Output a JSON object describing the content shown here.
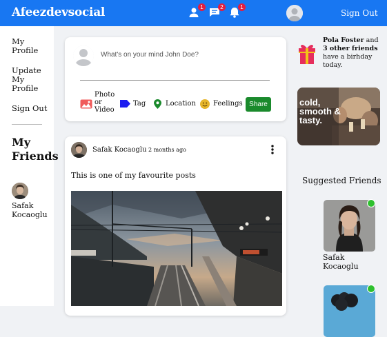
{
  "topbar": {
    "brand": "Afeezdevsocial",
    "badges": {
      "friends": "1",
      "messages": "2",
      "notifications": "1"
    },
    "sign_out": "Sign Out"
  },
  "sidebar": {
    "links": [
      {
        "label": "My Profile"
      },
      {
        "label": "Update My Profile"
      },
      {
        "label": "Sign Out"
      }
    ],
    "friends_heading": "My Friends",
    "friends": [
      {
        "name": "Safak Kocaoglu"
      }
    ]
  },
  "composer": {
    "placeholder": "What's on your mind John Doe?",
    "options": {
      "photo_video": "Photo or Video",
      "tag": "Tag",
      "location": "Location",
      "feelings": "Feelings"
    },
    "share_label": "Share"
  },
  "post": {
    "author": "Safak Kocaoglu",
    "time": "2 months ago",
    "text": "This is one of my favourite posts"
  },
  "rightbar": {
    "birthday": {
      "name": "Pola Foster",
      "middle": " and ",
      "others": "3 other friends",
      "rest": " have a birhday today."
    },
    "ad_text": "cold, smooth & tasty.",
    "suggested_heading": "Suggested Friends",
    "suggested": [
      {
        "name": "Safak Kocaoglu"
      }
    ]
  },
  "colors": {
    "topbar": "#1877f2",
    "badge": "#e41e3f",
    "share_button": "#1a8a2c",
    "online_dot": "#2ec02e"
  }
}
